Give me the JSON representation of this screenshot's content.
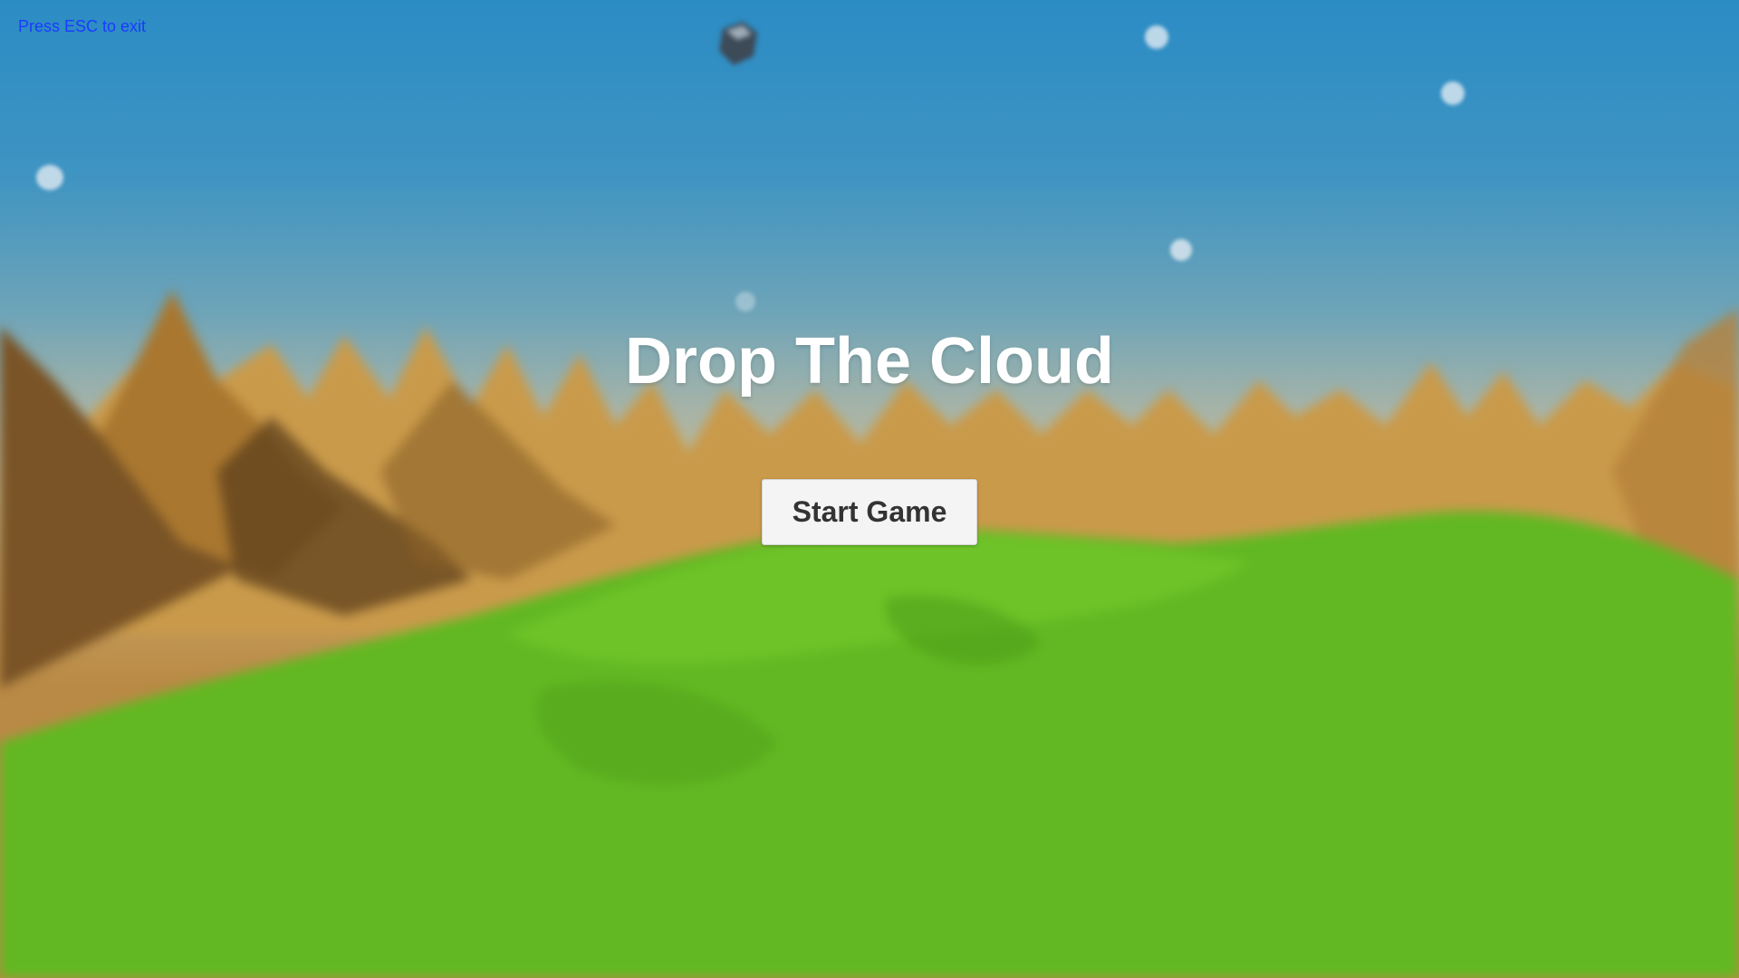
{
  "hud": {
    "esc_hint": "Press ESC to exit"
  },
  "menu": {
    "title": "Drop The Cloud",
    "start_button_label": "Start Game"
  },
  "colors": {
    "sky_top": "#2b8cc4",
    "sky_horizon": "#c8b98e",
    "mountains": "#c8963f",
    "mountains_shadow": "#6b4a24",
    "grass": "#62b822",
    "esc_hint": "#1a3bff",
    "title": "#ffffff",
    "button_bg": "#f4f4f4",
    "button_text": "#333333"
  }
}
